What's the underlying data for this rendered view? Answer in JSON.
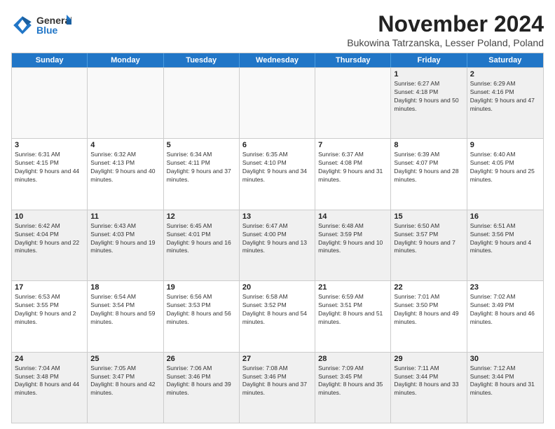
{
  "header": {
    "logo_general": "General",
    "logo_blue": "Blue",
    "title": "November 2024",
    "location": "Bukowina Tatrzanska, Lesser Poland, Poland"
  },
  "calendar": {
    "days_of_week": [
      "Sunday",
      "Monday",
      "Tuesday",
      "Wednesday",
      "Thursday",
      "Friday",
      "Saturday"
    ],
    "rows": [
      [
        {
          "day": "",
          "empty": true
        },
        {
          "day": "",
          "empty": true
        },
        {
          "day": "",
          "empty": true
        },
        {
          "day": "",
          "empty": true
        },
        {
          "day": "",
          "empty": true
        },
        {
          "day": "1",
          "sunrise": "Sunrise: 6:27 AM",
          "sunset": "Sunset: 4:18 PM",
          "daylight": "Daylight: 9 hours and 50 minutes."
        },
        {
          "day": "2",
          "sunrise": "Sunrise: 6:29 AM",
          "sunset": "Sunset: 4:16 PM",
          "daylight": "Daylight: 9 hours and 47 minutes."
        }
      ],
      [
        {
          "day": "3",
          "sunrise": "Sunrise: 6:31 AM",
          "sunset": "Sunset: 4:15 PM",
          "daylight": "Daylight: 9 hours and 44 minutes."
        },
        {
          "day": "4",
          "sunrise": "Sunrise: 6:32 AM",
          "sunset": "Sunset: 4:13 PM",
          "daylight": "Daylight: 9 hours and 40 minutes."
        },
        {
          "day": "5",
          "sunrise": "Sunrise: 6:34 AM",
          "sunset": "Sunset: 4:11 PM",
          "daylight": "Daylight: 9 hours and 37 minutes."
        },
        {
          "day": "6",
          "sunrise": "Sunrise: 6:35 AM",
          "sunset": "Sunset: 4:10 PM",
          "daylight": "Daylight: 9 hours and 34 minutes."
        },
        {
          "day": "7",
          "sunrise": "Sunrise: 6:37 AM",
          "sunset": "Sunset: 4:08 PM",
          "daylight": "Daylight: 9 hours and 31 minutes."
        },
        {
          "day": "8",
          "sunrise": "Sunrise: 6:39 AM",
          "sunset": "Sunset: 4:07 PM",
          "daylight": "Daylight: 9 hours and 28 minutes."
        },
        {
          "day": "9",
          "sunrise": "Sunrise: 6:40 AM",
          "sunset": "Sunset: 4:05 PM",
          "daylight": "Daylight: 9 hours and 25 minutes."
        }
      ],
      [
        {
          "day": "10",
          "sunrise": "Sunrise: 6:42 AM",
          "sunset": "Sunset: 4:04 PM",
          "daylight": "Daylight: 9 hours and 22 minutes."
        },
        {
          "day": "11",
          "sunrise": "Sunrise: 6:43 AM",
          "sunset": "Sunset: 4:03 PM",
          "daylight": "Daylight: 9 hours and 19 minutes."
        },
        {
          "day": "12",
          "sunrise": "Sunrise: 6:45 AM",
          "sunset": "Sunset: 4:01 PM",
          "daylight": "Daylight: 9 hours and 16 minutes."
        },
        {
          "day": "13",
          "sunrise": "Sunrise: 6:47 AM",
          "sunset": "Sunset: 4:00 PM",
          "daylight": "Daylight: 9 hours and 13 minutes."
        },
        {
          "day": "14",
          "sunrise": "Sunrise: 6:48 AM",
          "sunset": "Sunset: 3:59 PM",
          "daylight": "Daylight: 9 hours and 10 minutes."
        },
        {
          "day": "15",
          "sunrise": "Sunrise: 6:50 AM",
          "sunset": "Sunset: 3:57 PM",
          "daylight": "Daylight: 9 hours and 7 minutes."
        },
        {
          "day": "16",
          "sunrise": "Sunrise: 6:51 AM",
          "sunset": "Sunset: 3:56 PM",
          "daylight": "Daylight: 9 hours and 4 minutes."
        }
      ],
      [
        {
          "day": "17",
          "sunrise": "Sunrise: 6:53 AM",
          "sunset": "Sunset: 3:55 PM",
          "daylight": "Daylight: 9 hours and 2 minutes."
        },
        {
          "day": "18",
          "sunrise": "Sunrise: 6:54 AM",
          "sunset": "Sunset: 3:54 PM",
          "daylight": "Daylight: 8 hours and 59 minutes."
        },
        {
          "day": "19",
          "sunrise": "Sunrise: 6:56 AM",
          "sunset": "Sunset: 3:53 PM",
          "daylight": "Daylight: 8 hours and 56 minutes."
        },
        {
          "day": "20",
          "sunrise": "Sunrise: 6:58 AM",
          "sunset": "Sunset: 3:52 PM",
          "daylight": "Daylight: 8 hours and 54 minutes."
        },
        {
          "day": "21",
          "sunrise": "Sunrise: 6:59 AM",
          "sunset": "Sunset: 3:51 PM",
          "daylight": "Daylight: 8 hours and 51 minutes."
        },
        {
          "day": "22",
          "sunrise": "Sunrise: 7:01 AM",
          "sunset": "Sunset: 3:50 PM",
          "daylight": "Daylight: 8 hours and 49 minutes."
        },
        {
          "day": "23",
          "sunrise": "Sunrise: 7:02 AM",
          "sunset": "Sunset: 3:49 PM",
          "daylight": "Daylight: 8 hours and 46 minutes."
        }
      ],
      [
        {
          "day": "24",
          "sunrise": "Sunrise: 7:04 AM",
          "sunset": "Sunset: 3:48 PM",
          "daylight": "Daylight: 8 hours and 44 minutes."
        },
        {
          "day": "25",
          "sunrise": "Sunrise: 7:05 AM",
          "sunset": "Sunset: 3:47 PM",
          "daylight": "Daylight: 8 hours and 42 minutes."
        },
        {
          "day": "26",
          "sunrise": "Sunrise: 7:06 AM",
          "sunset": "Sunset: 3:46 PM",
          "daylight": "Daylight: 8 hours and 39 minutes."
        },
        {
          "day": "27",
          "sunrise": "Sunrise: 7:08 AM",
          "sunset": "Sunset: 3:46 PM",
          "daylight": "Daylight: 8 hours and 37 minutes."
        },
        {
          "day": "28",
          "sunrise": "Sunrise: 7:09 AM",
          "sunset": "Sunset: 3:45 PM",
          "daylight": "Daylight: 8 hours and 35 minutes."
        },
        {
          "day": "29",
          "sunrise": "Sunrise: 7:11 AM",
          "sunset": "Sunset: 3:44 PM",
          "daylight": "Daylight: 8 hours and 33 minutes."
        },
        {
          "day": "30",
          "sunrise": "Sunrise: 7:12 AM",
          "sunset": "Sunset: 3:44 PM",
          "daylight": "Daylight: 8 hours and 31 minutes."
        }
      ]
    ]
  }
}
